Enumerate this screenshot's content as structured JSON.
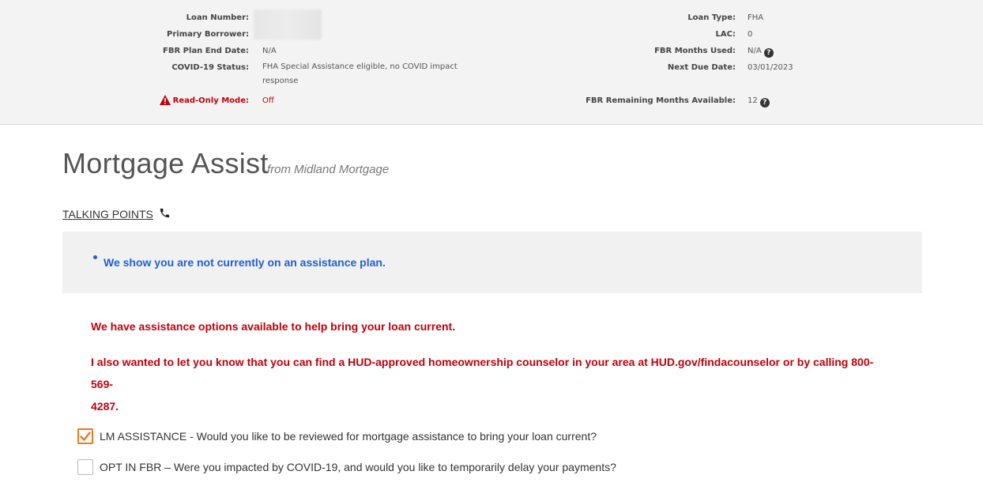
{
  "loan_info": {
    "left": [
      {
        "label": "Loan Number:",
        "value": ""
      },
      {
        "label": "Primary Borrower:",
        "value": ""
      },
      {
        "label": "FBR Plan End Date:",
        "value": "N/A"
      },
      {
        "label": "COVID-19 Status:",
        "value": "FHA Special Assistance eligible, no COVID impact response"
      },
      {
        "label": "Read-Only Mode:",
        "value": "Off"
      }
    ],
    "right": [
      {
        "label": "Loan Type:",
        "value": "FHA"
      },
      {
        "label": "LAC:",
        "value": "0"
      },
      {
        "label": "FBR Months Used:",
        "value": "N/A"
      },
      {
        "label": "Next Due Date:",
        "value": "03/01/2023"
      },
      {
        "label": "FBR Remaining Months Available:",
        "value": "12"
      }
    ],
    "help_glyph": "?"
  },
  "page": {
    "title": "Mortgage Assist",
    "subtitle": "from Midland Mortgage"
  },
  "talking_points": {
    "label": "TALKING POINTS",
    "bullet": "We show you are not currently on an assistance plan."
  },
  "messages": {
    "options": "We have assistance options available to help bring your loan current.",
    "hud_line1": "I also wanted to let you know that you can find a HUD-approved homeownership counselor in your area at HUD.gov/findacounselor or by calling 800-569-",
    "hud_line2": "4287."
  },
  "checkboxes": [
    {
      "label": "LM ASSISTANCE - Would you like to be reviewed for mortgage assistance to bring your loan current?",
      "checked": true
    },
    {
      "label": "OPT IN FBR – Were you impacted by COVID-19, and would you like to temporarily delay your payments?",
      "checked": false
    }
  ],
  "colors": {
    "alert_red": "#c0000b",
    "accent_blue": "#1f5fd6",
    "check_orange": "#e8791f"
  },
  "icons": {
    "warning": "warning-triangle-icon",
    "phone": "phone-icon",
    "help": "question-circle-icon",
    "check": "checkmark-icon"
  }
}
